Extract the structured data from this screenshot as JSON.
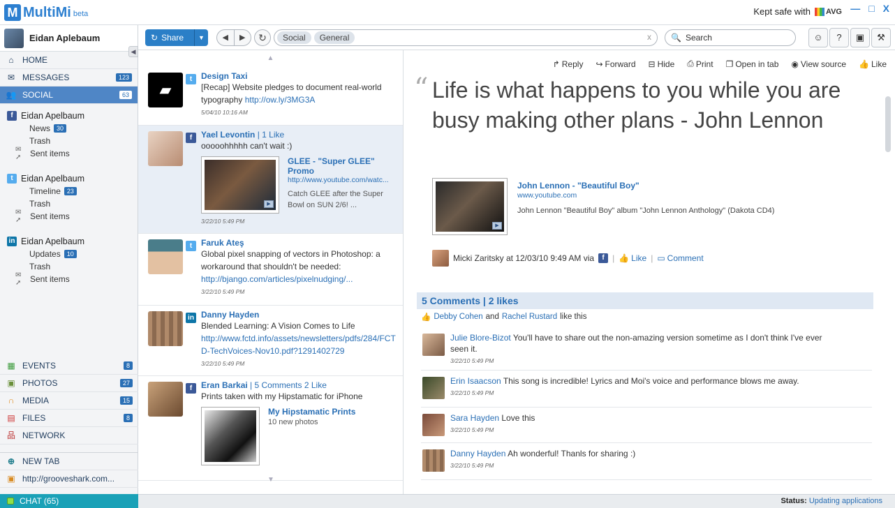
{
  "app": {
    "name": "MultiMi",
    "beta": "beta",
    "kept_safe": "Kept safe with",
    "avg": "AVG",
    "window_controls": [
      "—",
      "□",
      "X"
    ]
  },
  "profile": {
    "name": "Eidan Aplebaum"
  },
  "nav": {
    "home": "HOME",
    "messages": {
      "label": "MESSAGES",
      "count": "123"
    },
    "social": {
      "label": "SOCIAL",
      "count": "63"
    }
  },
  "accounts": [
    {
      "service": "facebook",
      "name": "Eidan Apelbaum",
      "items": [
        {
          "label": "News",
          "badge": "30"
        },
        {
          "label": "Trash",
          "badge": ""
        },
        {
          "label": "Sent items",
          "badge": ""
        }
      ]
    },
    {
      "service": "twitter",
      "name": "Eidan Apelbaum",
      "items": [
        {
          "label": "Timeline",
          "badge": "23"
        },
        {
          "label": "Trash",
          "badge": ""
        },
        {
          "label": "Sent items",
          "badge": ""
        }
      ]
    },
    {
      "service": "linkedin",
      "name": "Eidan Apelbaum",
      "items": [
        {
          "label": "Updates",
          "badge": "10"
        },
        {
          "label": "Trash",
          "badge": ""
        },
        {
          "label": "Sent items",
          "badge": ""
        }
      ]
    }
  ],
  "lower_nav": {
    "events": {
      "label": "EVENTS",
      "count": "8"
    },
    "photos": {
      "label": "PHOTOS",
      "count": "27"
    },
    "media": {
      "label": "MEDIA",
      "count": "15"
    },
    "files": {
      "label": "FILES",
      "count": "8"
    },
    "network": {
      "label": "NETWORK"
    },
    "new_tab": "NEW TAB",
    "grooveshark": "http://grooveshark.com..."
  },
  "chat": "CHAT (65)",
  "toolbar": {
    "share": "Share",
    "crumbs": [
      "Social",
      "General"
    ],
    "crumb_clear": "x",
    "search_placeholder": "Search",
    "icons": [
      "☺",
      "?",
      "▣",
      "⚒"
    ]
  },
  "feed": [
    {
      "service": "twitter",
      "author": "Design Taxi",
      "meta": "",
      "text": "[Recap] Website pledges to document real-world typography ",
      "link": "http://ow.ly/3MG3A",
      "time": "5/04/10 10:16 AM"
    },
    {
      "service": "facebook",
      "author": "Yael Levontin",
      "meta": "| 1 Like",
      "text": "ooooohhhhh can't wait :)",
      "embed": {
        "title": "GLEE - \"Super GLEE\" Promo",
        "url": "http://www.youtube.com/watc...",
        "desc": "Catch GLEE after the Super Bowl on SUN 2/6! ..."
      },
      "time": "3/22/10 5:49 PM"
    },
    {
      "service": "twitter",
      "author": "Faruk Ateş",
      "meta": "",
      "text": "Global pixel snapping of vectors in Photoshop: a workaround that shouldn't be needed:",
      "link": "http://bjango.com/articles/pixelnudging/...",
      "time": "3/22/10 5:49 PM"
    },
    {
      "service": "linkedin",
      "author": "Danny Hayden",
      "meta": "",
      "text": "Blended Learning: A Vision Comes to Life",
      "link": "http://www.fctd.info/assets/newsletters/pdfs/284/FCTD-TechVoices-Nov10.pdf?1291402729",
      "time": "3/22/10 5:49 PM"
    },
    {
      "service": "facebook",
      "author": "Eran Barkai",
      "meta": "| 5 Comments 2 Like",
      "text": "Prints taken with my Hipstamatic for iPhone",
      "embed": {
        "title": "My Hipstamatic Prints",
        "url": "",
        "desc": "10 new photos"
      },
      "time": ""
    }
  ],
  "reader": {
    "actions": {
      "reply": "Reply",
      "forward": "Forward",
      "hide": "Hide",
      "print": "Print",
      "open_tab": "Open in tab",
      "view_source": "View source",
      "like": "Like"
    },
    "quote": "Life is what happens to you while you are busy making other plans - John Lennon",
    "embed": {
      "title": "John Lennon - \"Beautiful Boy\"",
      "url": "www.youtube.com",
      "desc": "John Lennon \"Beautiful Boy\" album \"John Lennon Anthology\" (Dakota CD4)"
    },
    "posted_by": "Micki Zaritsky at 12/03/10 9:49 AM via",
    "like": "Like",
    "comment": "Comment",
    "comments_header": "5 Comments | 2 likes",
    "likers": {
      "a": "Debby Cohen",
      "and": "and",
      "b": "Rachel Rustard",
      "suffix": "like this"
    },
    "comments": [
      {
        "name": "Julie Blore-Bizot",
        "text": " You'll have to share out the non-amazing version sometime as I don't think I've ever seen it.",
        "time": "3/22/10 5:49 PM"
      },
      {
        "name": "Erin Isaacson",
        "text": " This song is incredible! Lyrics and Moi's voice and performance blows me away.",
        "time": "3/22/10 5:49 PM"
      },
      {
        "name": "Sara Hayden",
        "text": " Love this",
        "time": "3/22/10 5:49 PM"
      },
      {
        "name": "Danny Hayden",
        "text": " Ah wonderful! Thanls for sharing :)",
        "time": "3/22/10 5:49 PM"
      }
    ]
  },
  "status": {
    "label": "Status:",
    "value": "Updating applications"
  }
}
